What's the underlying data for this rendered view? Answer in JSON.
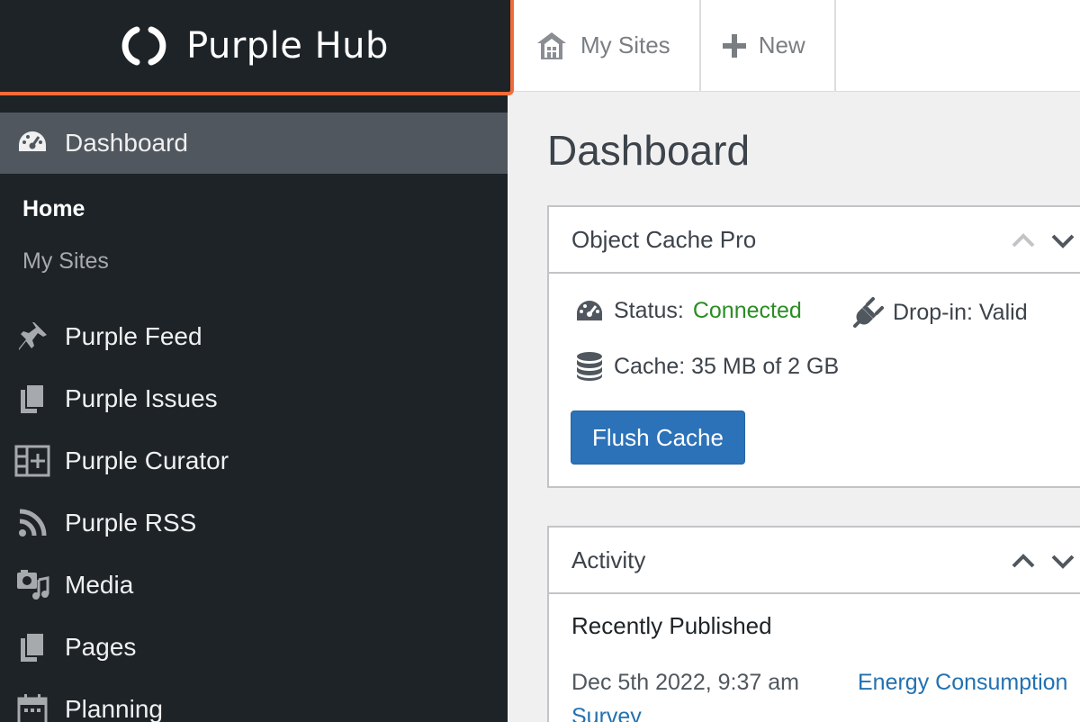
{
  "header": {
    "brand": "Purple Hub",
    "nav": [
      {
        "label": "My Sites",
        "icon": "sites-icon"
      },
      {
        "label": "New",
        "icon": "plus-icon"
      }
    ]
  },
  "sidebar": {
    "active": {
      "label": "Dashboard",
      "icon": "dashboard-icon"
    },
    "submenu": [
      {
        "label": "Home",
        "current": true
      },
      {
        "label": "My Sites",
        "current": false
      }
    ],
    "items": [
      {
        "label": "Purple Feed",
        "icon": "pin-icon"
      },
      {
        "label": "Purple Issues",
        "icon": "issues-icon"
      },
      {
        "label": "Purple Curator",
        "icon": "curator-icon"
      },
      {
        "label": "Purple RSS",
        "icon": "rss-icon"
      },
      {
        "label": "Media",
        "icon": "media-icon"
      },
      {
        "label": "Pages",
        "icon": "pages-icon"
      },
      {
        "label": "Planning",
        "icon": "calendar-icon"
      }
    ]
  },
  "main": {
    "title": "Dashboard",
    "object_cache": {
      "title": "Object Cache Pro",
      "status_label": "Status:",
      "status_value": "Connected",
      "dropin": "Drop-in: Valid",
      "cache": "Cache: 35 MB of 2 GB",
      "flush_button": "Flush Cache"
    },
    "activity": {
      "title": "Activity",
      "recently_published": "Recently Published",
      "rows": [
        {
          "date": "Dec 5th 2022, 9:37 am",
          "link_a": "Energy Consumption",
          "link_b": "Survey"
        }
      ]
    }
  },
  "colors": {
    "sidebar_bg": "#1d2327",
    "highlight_border": "#f26b3a",
    "primary_button": "#2c72b8",
    "status_ok": "#2a8d24",
    "link": "#2271b1"
  }
}
